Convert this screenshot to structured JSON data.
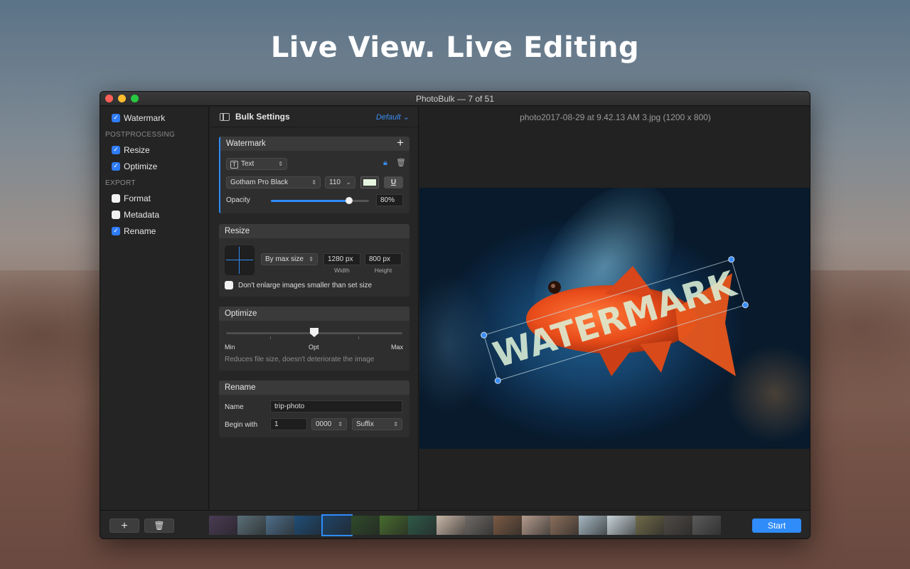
{
  "headline": "Live View. Live Editing",
  "window": {
    "title": "PhotoBulk — 7 of 51"
  },
  "sidebar": {
    "items": [
      {
        "label": "Watermark",
        "checked": true
      }
    ],
    "postprocessing_label": "POSTPROCESSING",
    "postprocessing": [
      {
        "label": "Resize",
        "checked": true
      },
      {
        "label": "Optimize",
        "checked": true
      }
    ],
    "export_label": "EXPORT",
    "export": [
      {
        "label": "Format",
        "checked": false
      },
      {
        "label": "Metadata",
        "checked": false
      },
      {
        "label": "Rename",
        "checked": true
      }
    ]
  },
  "settings": {
    "title": "Bulk Settings",
    "preset": "Default",
    "watermark": {
      "title": "Watermark",
      "type": "Text",
      "font": "Gotham Pro Black",
      "size": "110",
      "underline": "U",
      "opacity_label": "Opacity",
      "opacity_value": "80%",
      "opacity_level": 0.8,
      "color": "#e6f5df"
    },
    "resize": {
      "title": "Resize",
      "mode": "By max size",
      "width": "1280 px",
      "height": "800 px",
      "width_label": "Width",
      "height_label": "Height",
      "dont_enlarge": "Don't enlarge images smaller than set size"
    },
    "optimize": {
      "title": "Optimize",
      "min": "Min",
      "opt": "Opt",
      "max": "Max",
      "level": 0.5,
      "hint": "Reduces file size, doesn't deteriorate the image"
    },
    "rename": {
      "title": "Rename",
      "name_label": "Name",
      "name_value": "trip-photo",
      "begin_label": "Begin with",
      "begin_value": "1",
      "digits": "0000",
      "position": "Suffix"
    }
  },
  "preview": {
    "filename": "photo2017-08-29 at 9.42.13 AM 3.jpg (1200 x 800)",
    "watermark_text": "WATERMARK"
  },
  "bottom": {
    "add": "+",
    "start": "Start",
    "thumbnail_colors": [
      "#4a3b55",
      "#5a6f78",
      "#4e6e8a",
      "#1f4e78",
      "#1e4468",
      "#2f4a2a",
      "#476b2e",
      "#2f5a4a",
      "#c9b7a8",
      "#6e6a66",
      "#7a5a44",
      "#b39a8c",
      "#8a6e5a",
      "#a5b7c2",
      "#c8d4d9",
      "#6f6a4a",
      "#4f4a46",
      "#5a5a5a"
    ]
  },
  "colors": {
    "accent": "#2f8cf8",
    "checkbox_on": "#2f7cf6"
  }
}
